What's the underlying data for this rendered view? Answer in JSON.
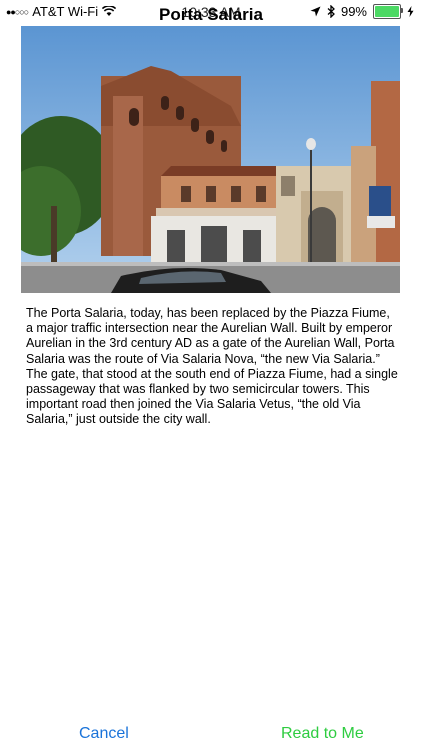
{
  "status_bar": {
    "signal": "●●○○○",
    "carrier": "AT&T Wi-Fi",
    "time": "10:33 AM",
    "battery_percent": "99%",
    "battery_level": 0.99
  },
  "nav": {
    "title": "Porta Salaria"
  },
  "photo": {
    "subject": "Porta Salaria brick tower and gate building"
  },
  "article": {
    "text": "The Porta Salaria, today, has been replaced by the Piazza Fiume, a major traffic intersection near the Aurelian Wall. Built by emperor Aurelian in the 3rd century AD as a gate of the Aurelian Wall, Porta Salaria was the route of Via Salaria Nova, “the new Via Salaria.” The gate, that stood at the south end of Piazza Fiume, had a single passageway that was flanked by two semicircular towers. This important road then joined the Via Salaria Vetus, “the old Via Salaria,” just outside the city wall."
  },
  "toolbar": {
    "cancel_label": "Cancel",
    "read_label": "Read to Me"
  },
  "colors": {
    "cancel": "#1a73d9",
    "read_to_me": "#2ecc40",
    "battery": "#4cd964"
  }
}
